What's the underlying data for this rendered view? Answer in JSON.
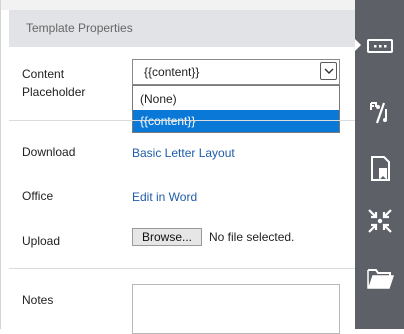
{
  "header": {
    "title": "Template Properties"
  },
  "fields": {
    "content_placeholder": {
      "label_line1": "Content",
      "label_line2": "Placeholder",
      "selected": "{{content}}",
      "options": [
        "(None)",
        "{{content}}"
      ]
    },
    "download": {
      "label": "Download",
      "link": "Basic Letter Layout"
    },
    "office": {
      "label": "Office",
      "link": "Edit in Word"
    },
    "upload": {
      "label": "Upload",
      "button": "Browse...",
      "status": "No file selected."
    },
    "notes": {
      "label": "Notes",
      "value": ""
    }
  },
  "sidebar_icons": [
    "properties-icon",
    "percent-replace-icon",
    "document-bookmark-icon",
    "compress-arrows-icon",
    "folder-icon"
  ],
  "colors": {
    "accent": "#0a78d7",
    "link": "#1f5da8",
    "rail": "#5d6067",
    "header_bg": "#e1e3e6"
  }
}
